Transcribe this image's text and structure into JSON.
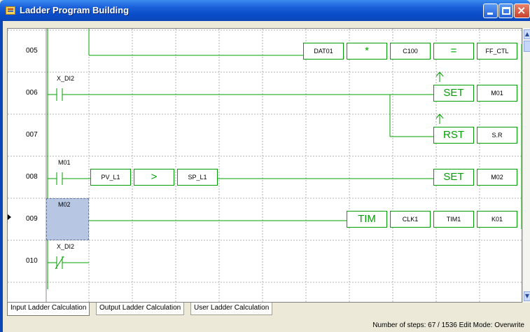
{
  "window": {
    "title": "Ladder Program Building"
  },
  "rows": [
    {
      "num": "005",
      "above_label": "",
      "selected": false
    },
    {
      "num": "006",
      "above_label": "X_DI2",
      "selected": false
    },
    {
      "num": "007",
      "above_label": "",
      "selected": false
    },
    {
      "num": "008",
      "above_label": "M01",
      "selected": false
    },
    {
      "num": "009",
      "above_label": "M02",
      "selected": true
    },
    {
      "num": "010",
      "above_label": "X_DI2",
      "selected": false
    }
  ],
  "ladder": {
    "r005": {
      "a": "DAT01",
      "op": "*",
      "b": "C100",
      "eq": "=",
      "dest": "FF_CTL"
    },
    "r006": {
      "cmd": "SET",
      "dest": "M01"
    },
    "r007": {
      "cmd": "RST",
      "dest": "S.R"
    },
    "r008": {
      "a": "PV_L1",
      "op": ">",
      "b": "SP_L1",
      "cmd": "SET",
      "dest": "M02"
    },
    "r009": {
      "cmd": "TIM",
      "p1": "CLK1",
      "p2": "TIM1",
      "p3": "K01"
    }
  },
  "tabs": [
    {
      "label": "Input Ladder Calculation",
      "active": true
    },
    {
      "label": "Output Ladder Calculation",
      "active": false
    },
    {
      "label": "User Ladder Calculation",
      "active": false
    }
  ],
  "status": {
    "text": "Number of steps: 67 / 1536 Edit Mode: Overwrite"
  },
  "colors": {
    "rung": "#00a000",
    "title_bar": "#0b46b8",
    "selection": "#b7c7e3"
  }
}
